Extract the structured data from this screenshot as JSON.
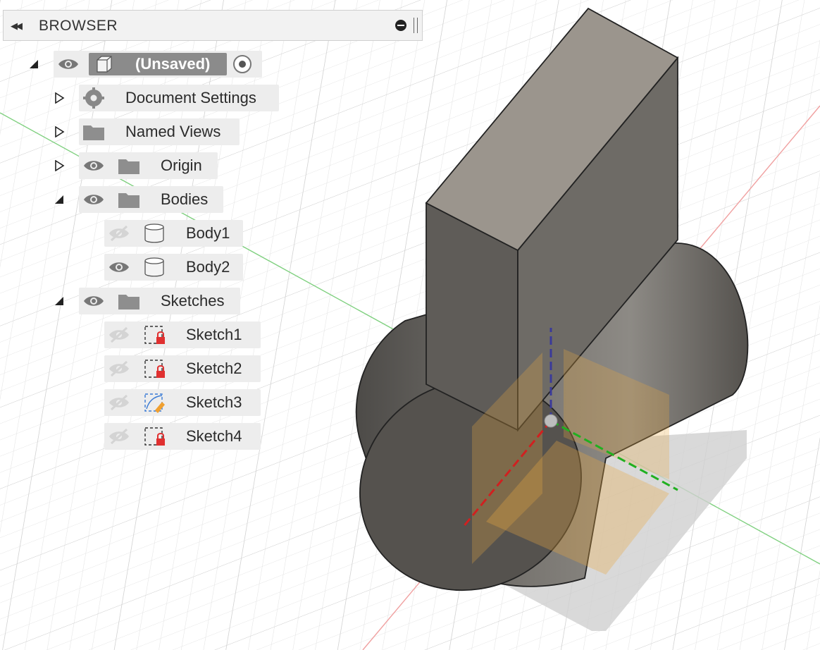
{
  "browser": {
    "title": "BROWSER",
    "root": {
      "label": "(Unsaved)"
    },
    "items": [
      {
        "label": "Document Settings"
      },
      {
        "label": "Named Views"
      },
      {
        "label": "Origin"
      },
      {
        "label": "Bodies"
      },
      {
        "label": "Body1"
      },
      {
        "label": "Body2"
      },
      {
        "label": "Sketches"
      },
      {
        "label": "Sketch1"
      },
      {
        "label": "Sketch2"
      },
      {
        "label": "Sketch3"
      },
      {
        "label": "Sketch4"
      }
    ]
  },
  "colors": {
    "x_axis": "#e06060",
    "y_axis": "#50c050",
    "z_axis": "#4040a0",
    "body": "#6a6660",
    "plane": "#e8a840"
  }
}
